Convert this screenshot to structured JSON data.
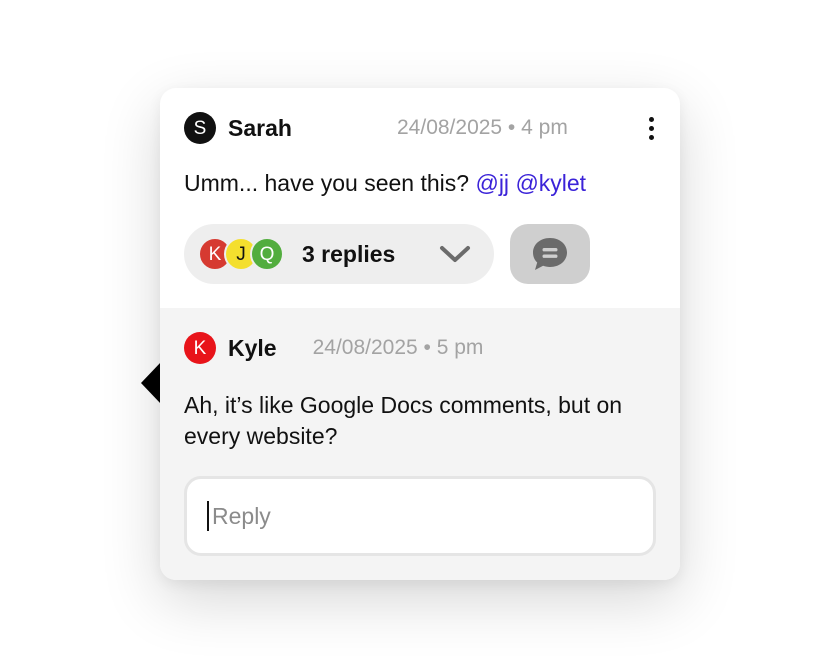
{
  "comment": {
    "author": "Sarah",
    "avatar_initial": "S",
    "avatar_color": "#111111",
    "timestamp": "24/08/2025 • 4 pm",
    "message_text": "Umm... have you seen this?",
    "mentions": [
      "@jj",
      "@kylet"
    ],
    "more_icon": "more-vertical-icon"
  },
  "replies_summary": {
    "label": "3 replies",
    "avatars": [
      {
        "initial": "K",
        "color": "#d63a31"
      },
      {
        "initial": "J",
        "color": "#f4df2e"
      },
      {
        "initial": "Q",
        "color": "#52ad3e"
      }
    ],
    "chevron_icon": "chevron-down-icon",
    "chat_icon": "chat-bubble-icon"
  },
  "reply": {
    "author": "Kyle",
    "avatar_initial": "K",
    "avatar_color": "#e8141a",
    "timestamp": "24/08/2025 • 5 pm",
    "message": "Ah, it’s like Google Docs comments, but on every website?"
  },
  "reply_input": {
    "placeholder": "Reply",
    "value": ""
  },
  "colors": {
    "mention": "#3b23d8",
    "muted_text": "#a3a3a3",
    "reply_background": "#f4f4f4"
  }
}
